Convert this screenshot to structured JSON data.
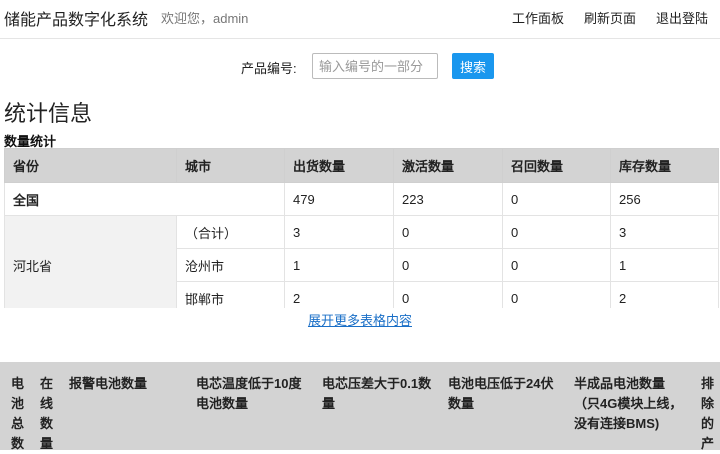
{
  "header": {
    "title": "储能产品数字化系统",
    "welcome": "欢迎您，admin",
    "nav": [
      "工作面板",
      "刷新页面",
      "退出登陆"
    ]
  },
  "search": {
    "label": "产品编号:",
    "placeholder": "输入编号的一部分",
    "button": "搜索"
  },
  "section": {
    "title": "统计信息",
    "subtitle": "数量统计"
  },
  "stats_table": {
    "headers": [
      "省份",
      "城市",
      "出货数量",
      "激活数量",
      "召回数量",
      "库存数量"
    ],
    "total": {
      "label": "全国",
      "shipped": "479",
      "activated": "223",
      "recalled": "0",
      "stock": "256"
    },
    "province": "河北省",
    "rows": [
      {
        "city": "（合计）",
        "shipped": "3",
        "activated": "0",
        "recalled": "0",
        "stock": "3"
      },
      {
        "city": "沧州市",
        "shipped": "1",
        "activated": "0",
        "recalled": "0",
        "stock": "1"
      },
      {
        "city": "邯郸市",
        "shipped": "2",
        "activated": "0",
        "recalled": "0",
        "stock": "2"
      }
    ]
  },
  "expand_link": "展开更多表格内容",
  "battery_table": {
    "col1": [
      "电",
      "池",
      "总",
      "数"
    ],
    "col2": [
      "在",
      "线",
      "数",
      "量"
    ],
    "col3": "报警电池数量",
    "col4": [
      "电芯温度低于10度",
      "电池数量"
    ],
    "col5": [
      "电芯压差大于0.1数",
      "量"
    ],
    "col6": [
      "电池电压低于24伏",
      "数量"
    ],
    "col7": [
      "半成品电池数量",
      "（只4G模块上线，",
      "没有连接BMS)"
    ],
    "col8": [
      "排",
      "除",
      "的",
      "产"
    ]
  },
  "colors": {
    "accent": "#1a97ee",
    "link": "#1a6fc7",
    "header_bg": "#d3d3d3"
  }
}
